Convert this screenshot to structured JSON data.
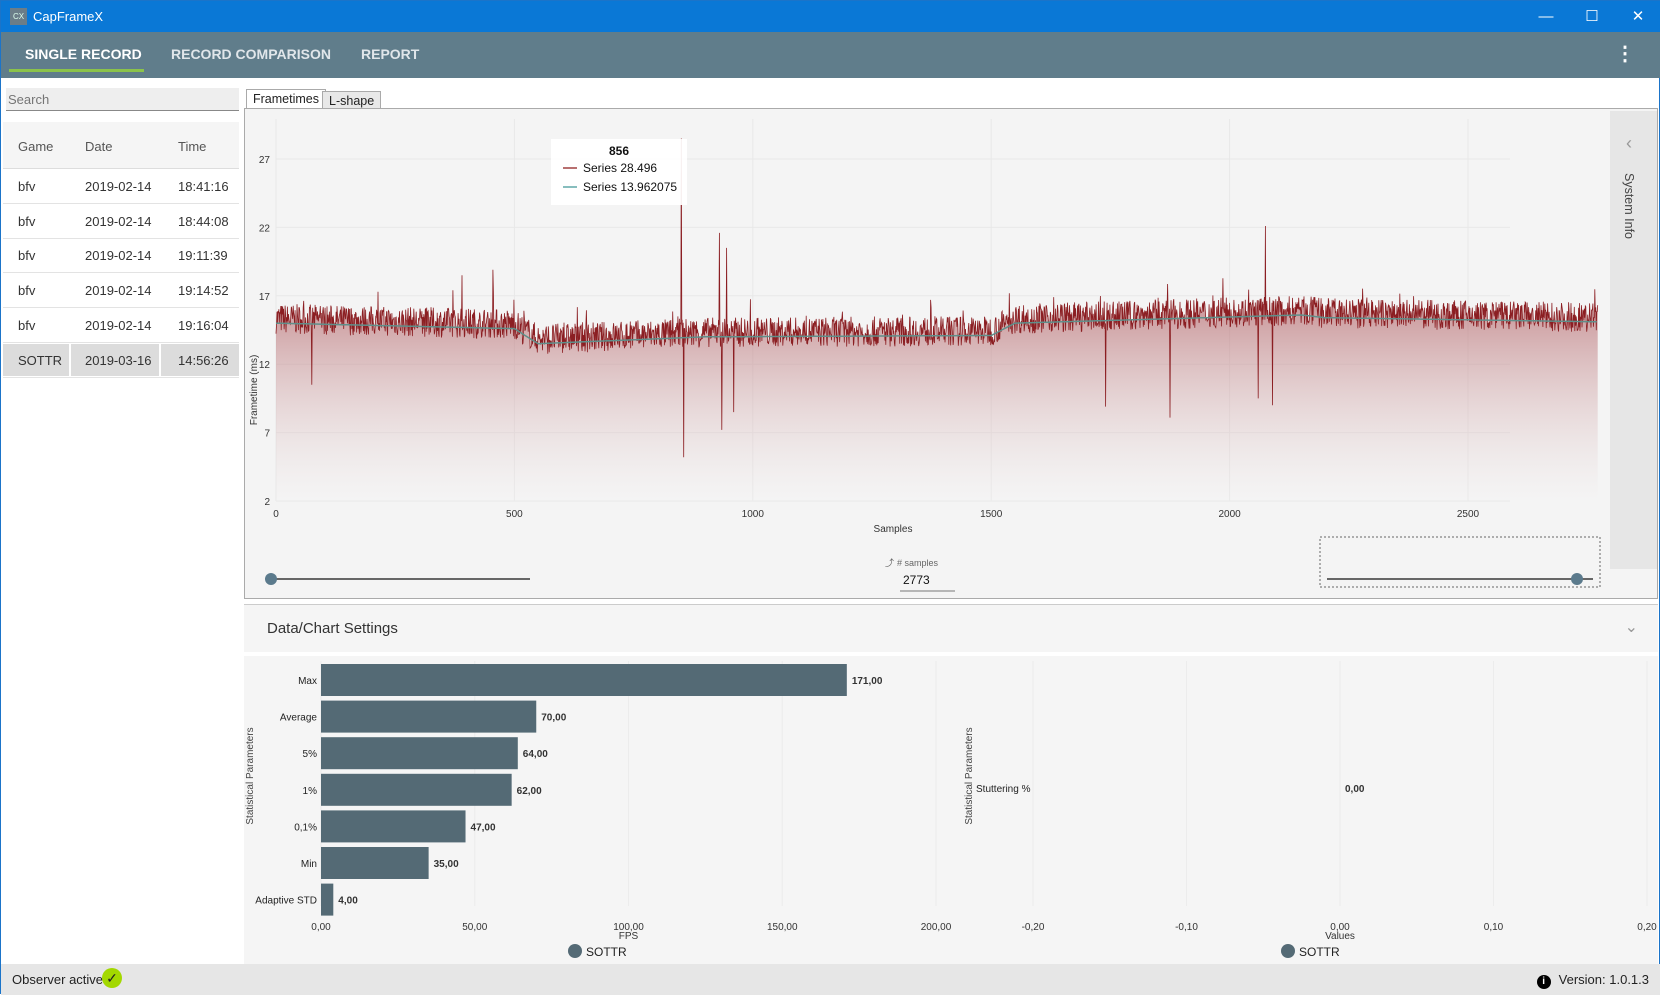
{
  "window": {
    "title": "CapFrameX",
    "icon_text": "CX",
    "minimize": "—",
    "maximize": "☐",
    "close": "✕"
  },
  "nav": {
    "tabs": [
      {
        "label": "SINGLE RECORD",
        "active": true
      },
      {
        "label": "RECORD COMPARISON"
      },
      {
        "label": "REPORT"
      }
    ],
    "menu_icon": "⋮"
  },
  "sidebar": {
    "search_placeholder": "Search",
    "columns": [
      "Game",
      "Date",
      "Time"
    ],
    "rows": [
      [
        "bfv",
        "2019-02-14",
        "18:41:16"
      ],
      [
        "bfv",
        "2019-02-14",
        "18:44:08"
      ],
      [
        "bfv",
        "2019-02-14",
        "19:11:39"
      ],
      [
        "bfv",
        "2019-02-14",
        "19:14:52"
      ],
      [
        "bfv",
        "2019-02-14",
        "19:16:04"
      ],
      [
        "SOTTR",
        "2019-03-16",
        "14:56:26"
      ]
    ],
    "selected_index": 5
  },
  "main": {
    "tabs": [
      "Frametimes",
      "L-shape"
    ],
    "active_tab": 0,
    "system_info": "System Info",
    "samples_label": "# samples",
    "samples_value": "2773",
    "range_start_fraction": 0.0,
    "range_end_fraction": 1.0,
    "settings_title": "Data/Chart Settings"
  },
  "chart_data": [
    {
      "type": "area",
      "ylabel": "Frametime (ms)",
      "xlabel": "Samples",
      "xlim": [
        0,
        2773
      ],
      "ylim": [
        2,
        29
      ],
      "xticks": [
        "0",
        "500",
        "1000",
        "1500",
        "2000",
        "2500"
      ],
      "yticks": [
        "2",
        "7",
        "12",
        "17",
        "22",
        "27"
      ],
      "series_colors": {
        "frametimes": "#8b1e22",
        "moving_average": "#5f8f8a"
      },
      "baseline_profile": {
        "x": [
          0,
          500,
          550,
          900,
          1500,
          1550,
          2150,
          2200,
          2773
        ],
        "y": [
          15,
          14.6,
          13.5,
          14,
          14.1,
          15,
          15.6,
          15.4,
          15.1
        ]
      },
      "spikes": [
        {
          "x": 75,
          "y": 20.6
        },
        {
          "x": 390,
          "y": 18.5
        },
        {
          "x": 455,
          "y": 18.9
        },
        {
          "x": 850,
          "y": 28.5
        },
        {
          "x": 930,
          "y": 21.6
        },
        {
          "x": 945,
          "y": 20.5
        },
        {
          "x": 1740,
          "y": 19.1
        },
        {
          "x": 1875,
          "y": 22.1
        },
        {
          "x": 2075,
          "y": 22.1
        },
        {
          "x": 2090,
          "y": 22.8
        }
      ],
      "dips": [
        {
          "x": 75,
          "y": 10.5
        },
        {
          "x": 855,
          "y": 5.2
        },
        {
          "x": 935,
          "y": 7.2
        },
        {
          "x": 960,
          "y": 8.5
        },
        {
          "x": 1740,
          "y": 8.9
        },
        {
          "x": 1875,
          "y": 8.1
        },
        {
          "x": 2060,
          "y": 9.5
        },
        {
          "x": 2090,
          "y": 9.0
        }
      ],
      "tooltip": {
        "title": "856",
        "items": [
          {
            "name": "Series",
            "value": "28.496",
            "color": "#a04040"
          },
          {
            "name": "Series",
            "value": "13.962075",
            "color": "#5fa8a8"
          }
        ]
      }
    },
    {
      "type": "bar",
      "orientation": "horizontal",
      "ylabel": "Statistical Parameters",
      "xlabel": "FPS",
      "xlim": [
        0,
        200
      ],
      "xticks": [
        "0,00",
        "50,00",
        "100,00",
        "150,00",
        "200,00"
      ],
      "categories": [
        "Max",
        "Average",
        "5%",
        "1%",
        "0,1%",
        "Min",
        "Adaptive STD"
      ],
      "values": [
        171,
        70,
        64,
        62,
        47,
        35,
        4
      ],
      "labels": [
        "171,00",
        "70,00",
        "64,00",
        "62,00",
        "47,00",
        "35,00",
        "4,00"
      ],
      "legend": "SOTTR",
      "color": "#546a75"
    },
    {
      "type": "bar",
      "orientation": "horizontal",
      "ylabel": "Statistical Parameters",
      "xlabel": "Values",
      "xlim": [
        -0.2,
        0.2
      ],
      "xticks": [
        "-0,20",
        "-0,10",
        "0,00",
        "0,10",
        "0,20"
      ],
      "categories": [
        "Stuttering %"
      ],
      "values": [
        0
      ],
      "labels": [
        "0,00"
      ],
      "legend": "SOTTR",
      "color": "#546a75"
    }
  ],
  "status": {
    "observer": "Observer active:",
    "observer_ok": true,
    "version": "Version: 1.0.1.3"
  }
}
